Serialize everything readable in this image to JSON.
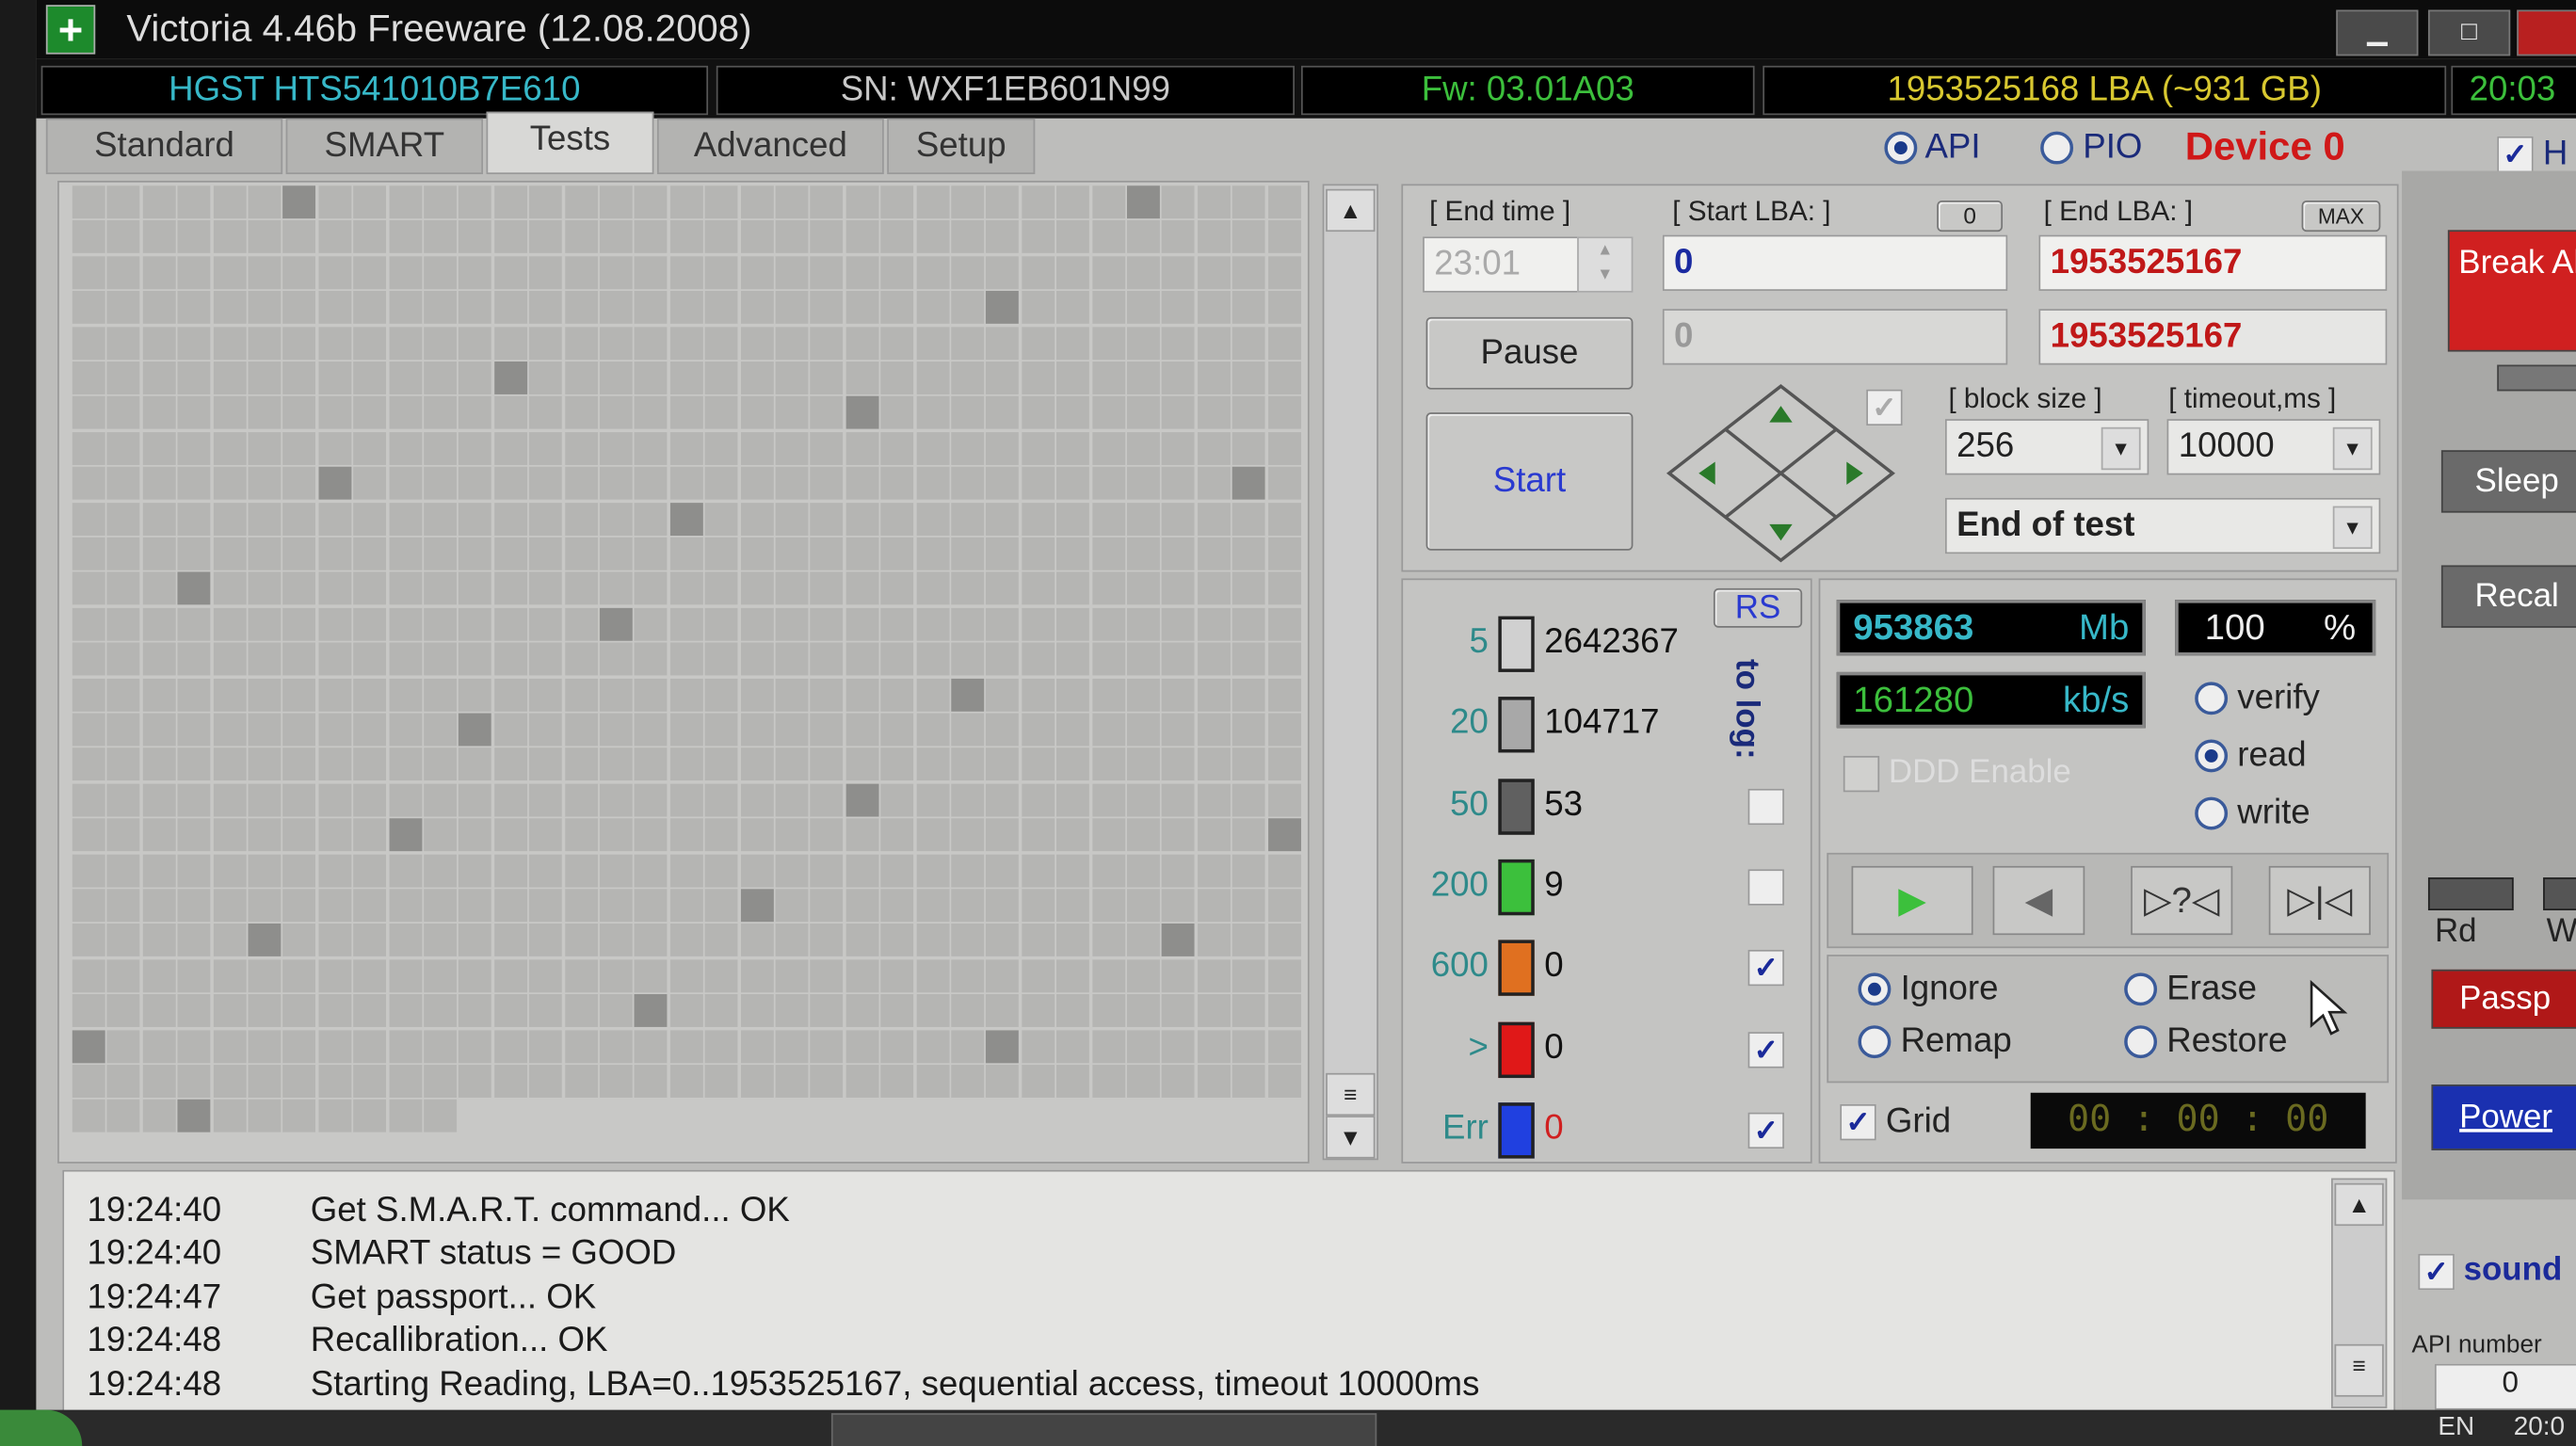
{
  "window": {
    "title": "Victoria 4.46b Freeware (12.08.2008)",
    "minimize": "▁",
    "maximize": "□"
  },
  "info": {
    "model": "HGST HTS541010B7E610",
    "serial": "SN: WXF1EB601N99",
    "firmware": "Fw: 03.01A03",
    "capacity": "1953525168 LBA (~931 GB)",
    "clock": "20:03",
    "colors": {
      "model": "#37b8c8",
      "serial": "#c8c8c8",
      "firmware": "#3cbf3c",
      "capacity": "#d8c830",
      "clock": "#3cbf3c"
    }
  },
  "tabs": [
    {
      "label": "Standard"
    },
    {
      "label": "SMART"
    },
    {
      "label": "Tests",
      "active": true
    },
    {
      "label": "Advanced"
    },
    {
      "label": "Setup"
    }
  ],
  "mode": {
    "api": "API",
    "pio": "PIO",
    "selected": "API",
    "device": "Device 0",
    "h_checkbox": "H"
  },
  "test": {
    "end_time_label": "[ End time ]",
    "end_time": "23:01",
    "start_lba_label": "[ Start LBA: ]",
    "start_lba": "0",
    "start_lba_current": "0",
    "zero_button": "0",
    "end_lba_label": "[ End LBA: ]",
    "max_button": "MAX",
    "end_lba": "1953525167",
    "end_lba_current": "1953525167",
    "pause": "Pause",
    "start": "Start",
    "block_size_label": "[ block size ]",
    "block_size": "256",
    "timeout_label": "[ timeout,ms ]",
    "timeout": "10000",
    "end_action": "End of test"
  },
  "legend": {
    "rs": "RS",
    "to_log": "to log:",
    "rows": [
      {
        "label": "5",
        "count": "2642367",
        "color": "#d0d0d0",
        "log": null
      },
      {
        "label": "20",
        "count": "104717",
        "color": "#a8a8a8",
        "log": null
      },
      {
        "label": "50",
        "count": "53",
        "color": "#606060",
        "log": false
      },
      {
        "label": "200",
        "count": "9",
        "color": "#3cc03c",
        "log": false
      },
      {
        "label": "600",
        "count": "0",
        "color": "#e07020",
        "log": true
      },
      {
        "label": ">",
        "count": "0",
        "color": "#e01818",
        "log": true
      },
      {
        "label": "Err",
        "count": "0",
        "color": "#2040e0",
        "log": true
      }
    ]
  },
  "stats": {
    "processed": "953863",
    "processed_unit": "Mb",
    "percent": "100",
    "percent_unit": "%",
    "speed": "161280",
    "speed_unit": "kb/s",
    "ddd": "DDD Enable",
    "progress_percent": 100
  },
  "scan_mode": {
    "options": [
      "verify",
      "read",
      "write"
    ],
    "selected": "read"
  },
  "transport": {
    "play": "▶",
    "back": "◀",
    "unknown": "▷?◁",
    "end": "▷|◁"
  },
  "error_action": {
    "options": [
      "Ignore",
      "Erase",
      "Remap",
      "Restore"
    ],
    "selected": "Ignore"
  },
  "grid_toggle": {
    "label": "Grid",
    "checked": true
  },
  "timer": "00 : 00 : 00",
  "sidebar": {
    "break_all": "Break All",
    "sleep": "Sleep",
    "recal": "Recal",
    "rd": "Rd",
    "wr": "Wr",
    "passport": "Passp",
    "power": "Power",
    "sound": "sound",
    "api_number_label": "API number",
    "api_number": "0"
  },
  "log": [
    {
      "time": "19:24:40",
      "msg": "Get S.M.A.R.T. command... OK"
    },
    {
      "time": "19:24:40",
      "msg": "SMART status = GOOD"
    },
    {
      "time": "19:24:47",
      "msg": "Get passport... OK"
    },
    {
      "time": "19:24:48",
      "msg": "Recallibration... OK"
    },
    {
      "time": "19:24:48",
      "msg": "Starting Reading, LBA=0..1953525167, sequential access, timeout 10000ms"
    }
  ],
  "taskbar": {
    "lang": "EN",
    "clock": "20:0"
  }
}
